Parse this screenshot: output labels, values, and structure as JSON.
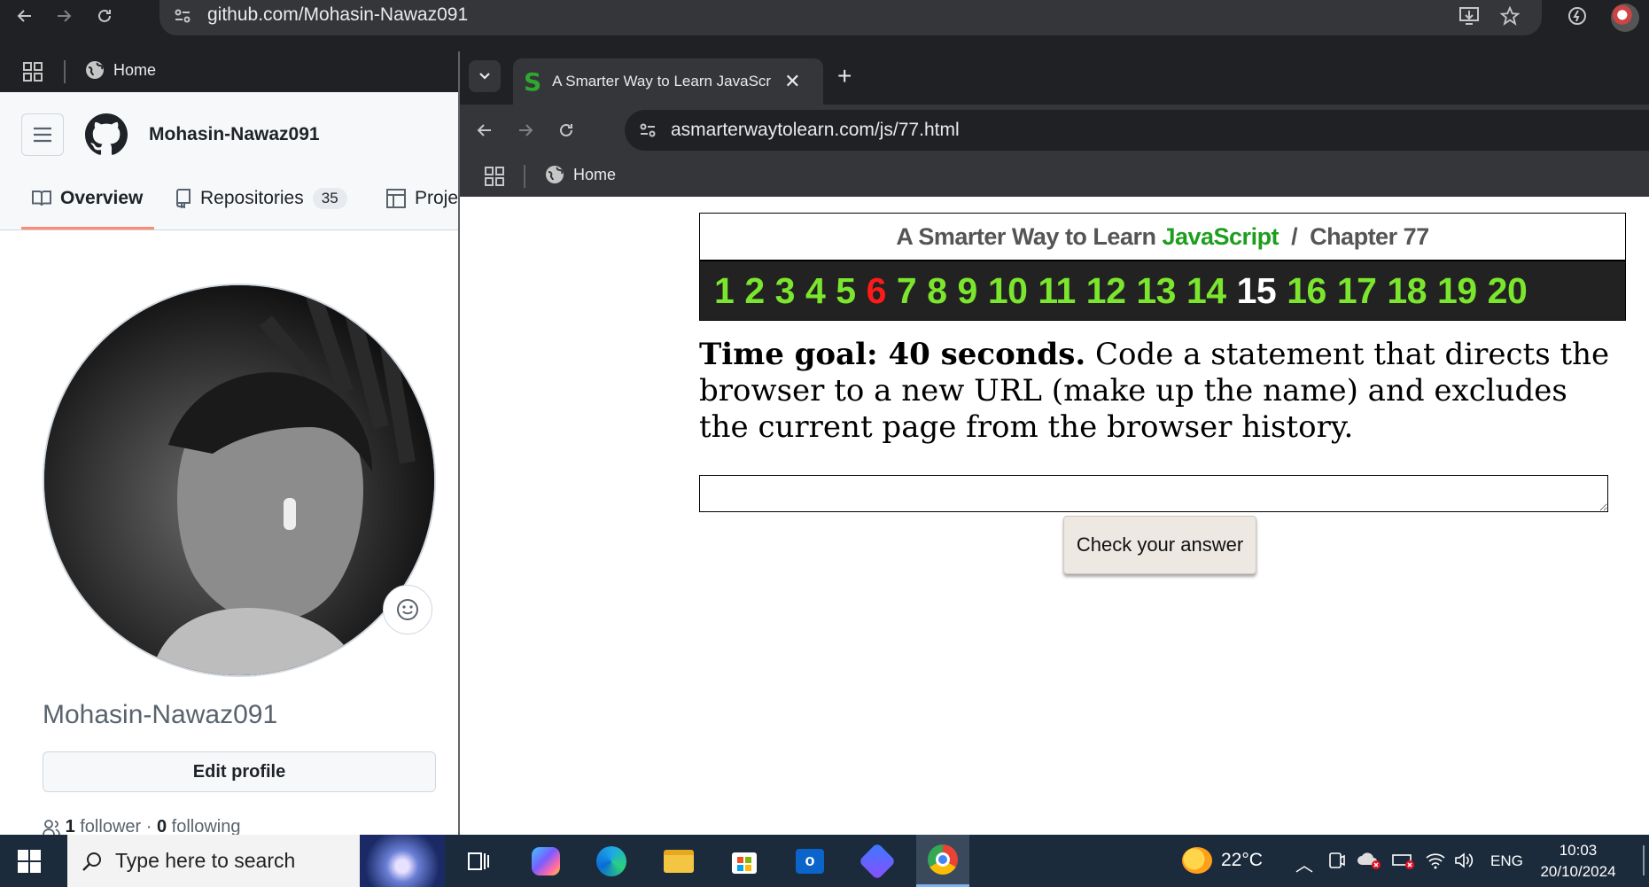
{
  "background_browser": {
    "url": "github.com/Mohasin-Nawaz091",
    "bookmark_home": "Home"
  },
  "github": {
    "username_header": "Mohasin-Nawaz091",
    "tabs": [
      {
        "label": "Overview"
      },
      {
        "label": "Repositories",
        "count": "35"
      },
      {
        "label": "Proje"
      }
    ],
    "profile_name": "Mohasin-Nawaz091",
    "edit_profile": "Edit profile",
    "followers_count": "1",
    "followers_label": "follower",
    "separator": "·",
    "following_count": "0",
    "following_label": "following"
  },
  "foreground_browser": {
    "tab_title": "A Smarter Way to Learn JavaScr",
    "url": "asmarterwaytolearn.com/js/77.html",
    "bookmark_home": "Home"
  },
  "site": {
    "header_prefix": "A Smarter Way to Learn ",
    "header_js": "JavaScript",
    "header_suffix": "  /  Chapter 77",
    "chapters": [
      "1",
      "2",
      "3",
      "4",
      "5",
      "6",
      "7",
      "8",
      "9",
      "10",
      "11",
      "12",
      "13",
      "14",
      "15",
      "16",
      "17",
      "18",
      "19",
      "20"
    ],
    "question_goal": "Time goal: 40 seconds.",
    "question_text": " Code a statement that directs the browser to a new URL (make up the name) and excludes the current page from the browser history.",
    "check_button": "Check your answer",
    "answer_value": ""
  },
  "taskbar": {
    "search_placeholder": "Type here to search",
    "temperature": "22°C",
    "language": "ENG",
    "time": "10:03",
    "date": "20/10/2024"
  },
  "colors": {
    "chapter_green": "#7be62d",
    "chapter_current": "#ff1a1a",
    "chapter_done": "#ffffff",
    "js_green": "#1e9e1e"
  }
}
